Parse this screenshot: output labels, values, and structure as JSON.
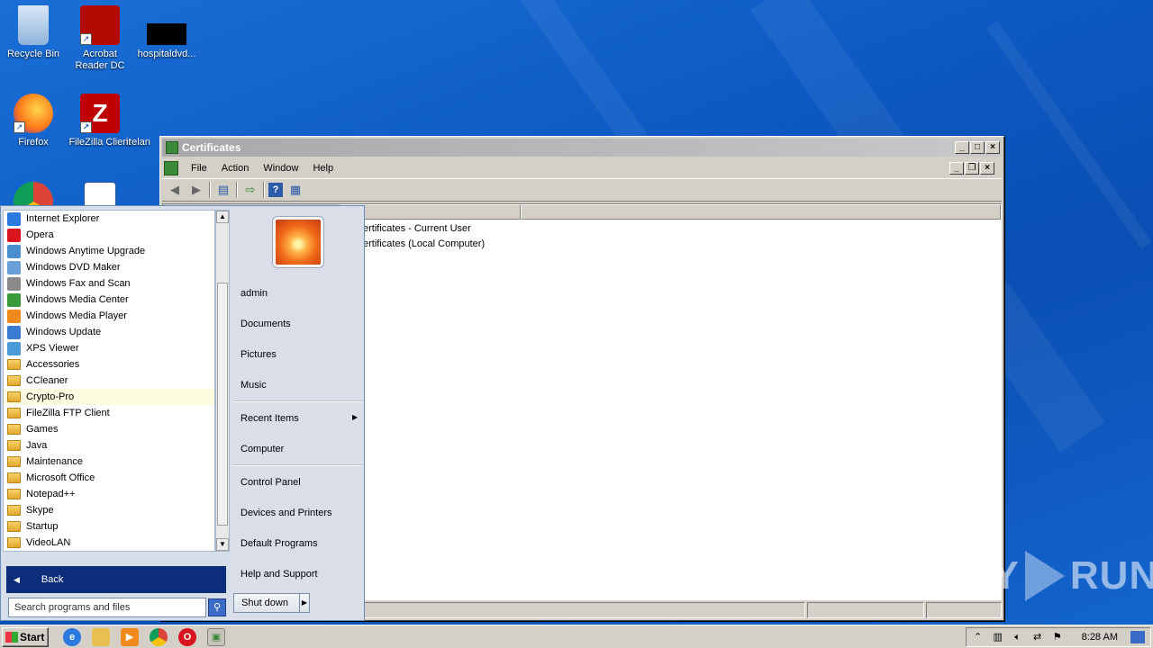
{
  "desktop": {
    "icons": [
      {
        "label": "Recycle Bin",
        "name": "recycle-bin-icon",
        "color": "#9fc3e8"
      },
      {
        "label": "Acrobat Reader DC",
        "name": "acrobat-reader-icon",
        "color": "#b30b00"
      },
      {
        "label": "hospitaldvd...",
        "name": "hospitaldvd-icon",
        "color": "#000000"
      },
      {
        "label": "Firefox",
        "name": "firefox-icon",
        "color": "#ff7a1a"
      },
      {
        "label": "FileZilla Client",
        "name": "filezilla-icon",
        "color": "#bf0000"
      },
      {
        "label": "irelan",
        "name": "irelan-icon",
        "color": "#1a6fd6"
      }
    ]
  },
  "window": {
    "title": "Certificates",
    "menu": [
      "File",
      "Action",
      "Window",
      "Help"
    ],
    "columns": [
      "e",
      ""
    ],
    "rows": [
      "ertificates - Current User",
      "ertificates (Local Computer)"
    ]
  },
  "startmenu": {
    "programs": [
      {
        "label": "Internet Explorer",
        "color": "#2a7ae0"
      },
      {
        "label": "Opera",
        "color": "#d8141e"
      },
      {
        "label": "Windows Anytime Upgrade",
        "color": "#4a90d0"
      },
      {
        "label": "Windows DVD Maker",
        "color": "#6aa0d8"
      },
      {
        "label": "Windows Fax and Scan",
        "color": "#8a8a8a"
      },
      {
        "label": "Windows Media Center",
        "color": "#3a9a3a"
      },
      {
        "label": "Windows Media Player",
        "color": "#f08a1a"
      },
      {
        "label": "Windows Update",
        "color": "#3a7ad0"
      },
      {
        "label": "XPS Viewer",
        "color": "#4a9ad8"
      },
      {
        "label": "Accessories",
        "folder": true
      },
      {
        "label": "CCleaner",
        "folder": true
      },
      {
        "label": "Crypto-Pro",
        "folder": true,
        "highlight": true
      },
      {
        "label": "FileZilla FTP Client",
        "folder": true
      },
      {
        "label": "Games",
        "folder": true
      },
      {
        "label": "Java",
        "folder": true
      },
      {
        "label": "Maintenance",
        "folder": true
      },
      {
        "label": "Microsoft Office",
        "folder": true
      },
      {
        "label": "Notepad++",
        "folder": true
      },
      {
        "label": "Skype",
        "folder": true
      },
      {
        "label": "Startup",
        "folder": true
      },
      {
        "label": "VideoLAN",
        "folder": true
      }
    ],
    "back_label": "Back",
    "search_placeholder": "Search programs and files",
    "right_items": {
      "admin": "admin",
      "documents": "Documents",
      "pictures": "Pictures",
      "music": "Music",
      "recent": "Recent Items",
      "computer": "Computer",
      "control_panel": "Control Panel",
      "devices": "Devices and Printers",
      "default_programs": "Default Programs",
      "help": "Help and Support"
    },
    "shutdown_label": "Shut down"
  },
  "taskbar": {
    "start_label": "Start",
    "clock": "8:28 AM"
  },
  "watermark": {
    "left": "ANY",
    "right": "RUN"
  }
}
